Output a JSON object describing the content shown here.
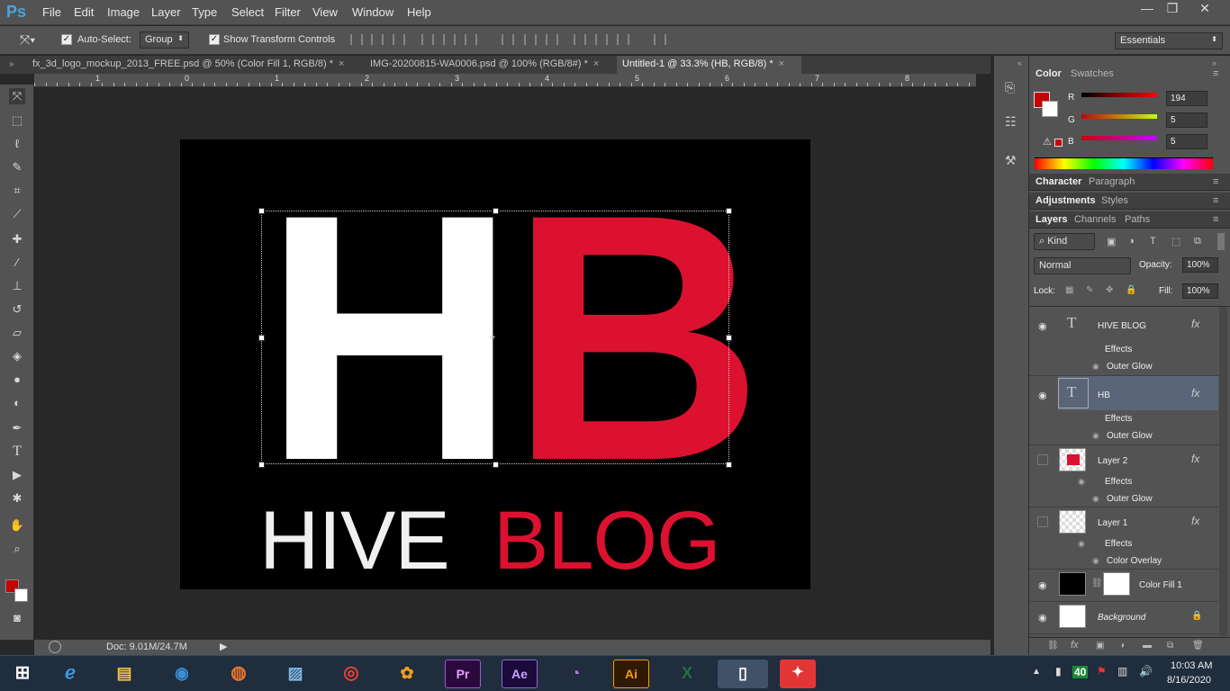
{
  "app": {
    "logo": "Ps",
    "menu": [
      "File",
      "Edit",
      "Image",
      "Layer",
      "Type",
      "Select",
      "Filter",
      "View",
      "Window",
      "Help"
    ],
    "window_controls": {
      "minimize": "—",
      "restore": "❐",
      "close": "✕"
    }
  },
  "options_bar": {
    "auto_select_label": "Auto-Select:",
    "auto_select_checked": true,
    "auto_select_mode": "Group",
    "show_transform_label": "Show Transform Controls",
    "show_transform_checked": true,
    "workspace": "Essentials"
  },
  "tabs": [
    {
      "label": "fx_3d_logo_mockup_2013_FREE.psd @ 50% (Color Fill 1, RGB/8) *",
      "close": "×"
    },
    {
      "label": "IMG-20200815-WA0006.psd @ 100% (RGB/8#) *",
      "close": "×"
    },
    {
      "label": "Untitled-1 @ 33.3% (HB, RGB/8) *",
      "close": "×",
      "active": true
    }
  ],
  "ruler": {
    "labels": [
      "1",
      "0",
      "1",
      "2",
      "3",
      "4",
      "5",
      "6",
      "7",
      "8"
    ]
  },
  "canvas": {
    "h_letter": "H",
    "b_letter": "B",
    "hive_word": "HIVE",
    "blog_word": "BLOG",
    "white": "#ffffff",
    "red": "#dc1130",
    "background": "#000000"
  },
  "status": {
    "doc": "Doc: 9.01M/24.7M"
  },
  "color_panel": {
    "tabs": [
      "Color",
      "Swatches"
    ],
    "r_label": "R",
    "r_value": "194",
    "g_label": "G",
    "g_value": "5",
    "b_label": "B",
    "b_value": "5",
    "foreground": "#c20505"
  },
  "panel_tabs": {
    "character": [
      "Character",
      "Paragraph"
    ],
    "adjustments": [
      "Adjustments",
      "Styles"
    ],
    "layers": [
      "Layers",
      "Channels",
      "Paths"
    ]
  },
  "layers_panel": {
    "kind": "Kind",
    "blend": "Normal",
    "opacity_label": "Opacity:",
    "opacity": "100%",
    "lock_label": "Lock:",
    "fill_label": "Fill:",
    "fill": "100%",
    "layers": [
      {
        "name": "HIVE BLOG",
        "effects": "Effects",
        "effect": "Outer Glow",
        "visible": true
      },
      {
        "name": "HB",
        "effects": "Effects",
        "effect": "Outer Glow",
        "visible": true,
        "selected": true
      },
      {
        "name": "Layer 2",
        "effects": "Effects",
        "effect": "Outer Glow",
        "visible": false
      },
      {
        "name": "Layer 1",
        "effects": "Effects",
        "effect": "Color Overlay",
        "visible": false
      },
      {
        "name": "Color Fill 1",
        "visible": true
      },
      {
        "name": "Background",
        "visible": true
      }
    ],
    "fx": "fx"
  },
  "taskbar": {
    "apps": [
      "Pr",
      "Ae",
      "Ai"
    ],
    "tray_badge": "40",
    "time": "10:03 AM",
    "date": "8/16/2020"
  }
}
